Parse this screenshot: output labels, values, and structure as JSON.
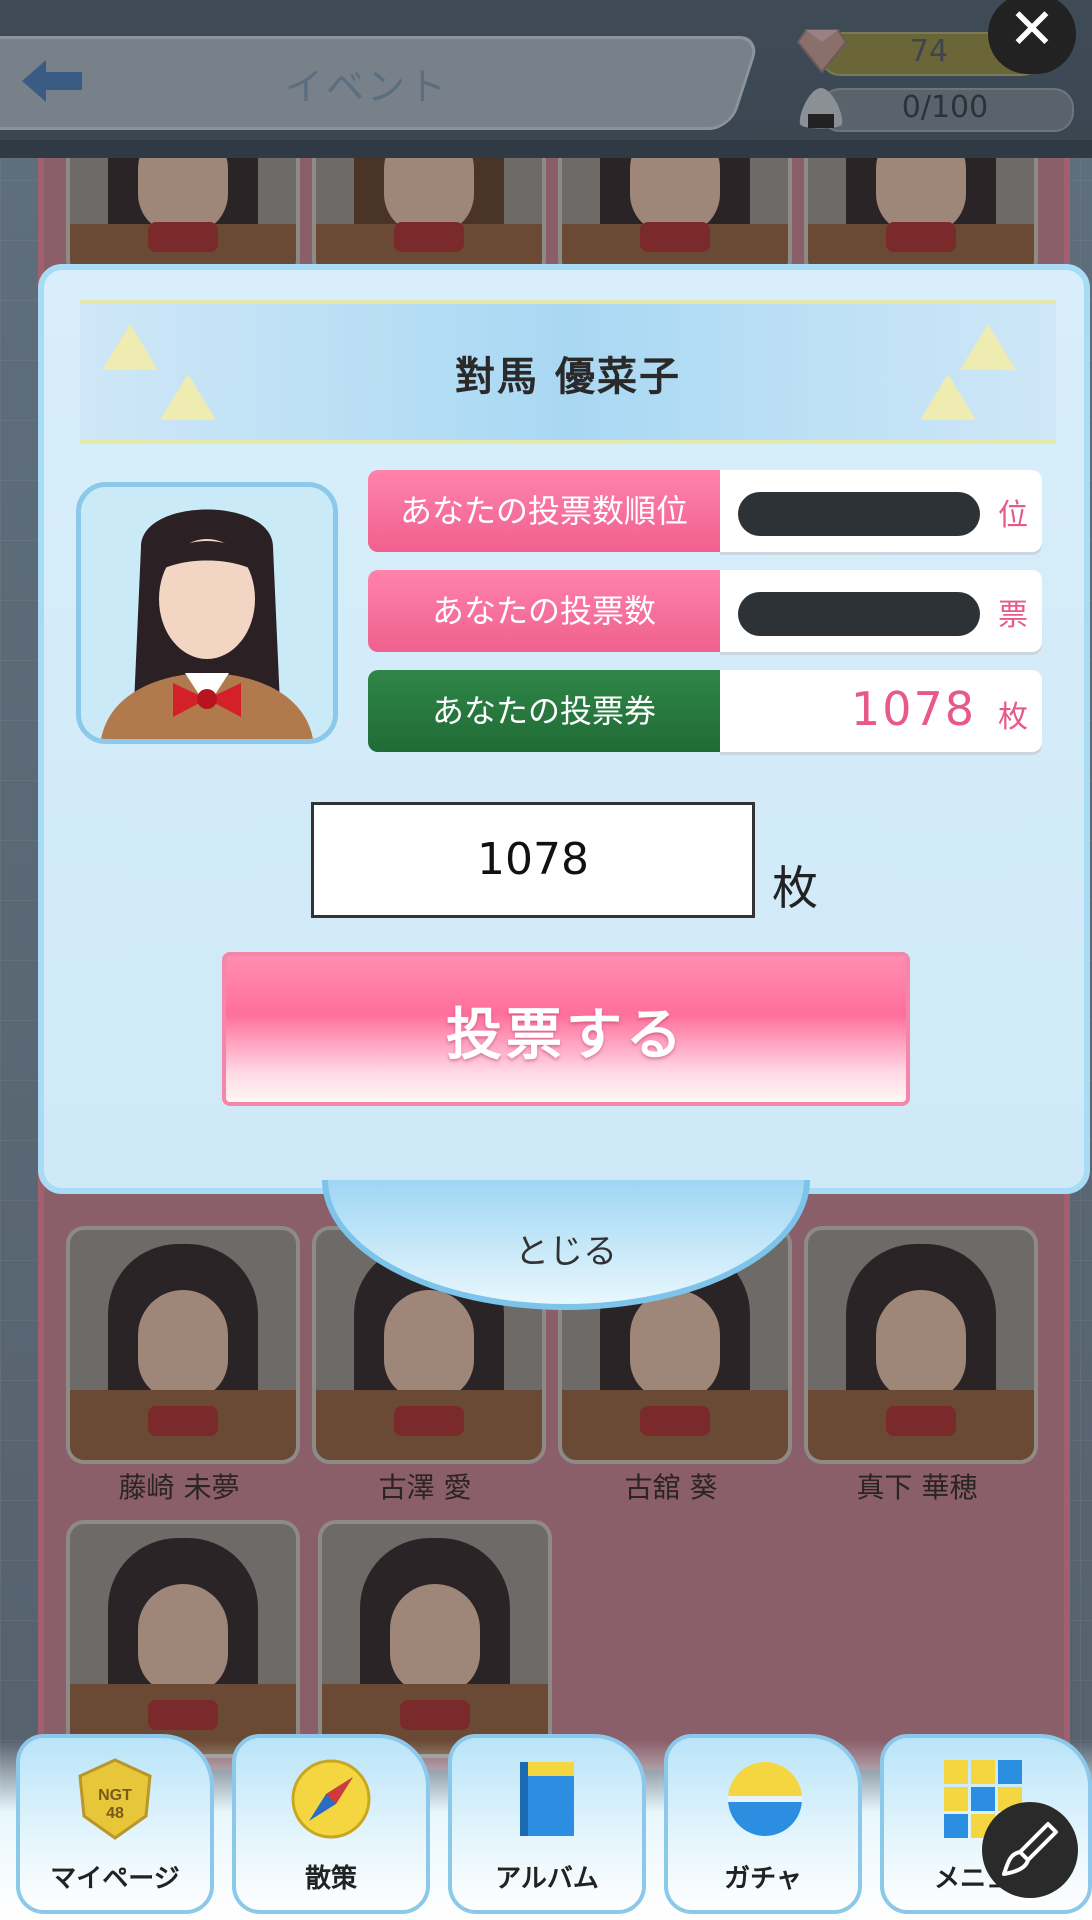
{
  "header": {
    "title": "イベント",
    "gem_count": "74",
    "stamina": "0/100",
    "close_glyph": "✕"
  },
  "modal": {
    "member_name": "對馬 優菜子",
    "stats": [
      {
        "label": "あなたの投票数順位",
        "unit": "位",
        "value_hidden": true
      },
      {
        "label": "あなたの投票数",
        "unit": "票",
        "value_hidden": true
      },
      {
        "label": "あなたの投票券",
        "value": "1078",
        "unit": "枚"
      }
    ],
    "quantity_input": "1078",
    "quantity_unit": "枚",
    "vote_button": "投票する",
    "close_button": "とじる"
  },
  "members": [
    {
      "name": "藤崎 未夢"
    },
    {
      "name": "古澤 愛"
    },
    {
      "name": "古舘 葵"
    },
    {
      "name": "真下 華穂"
    }
  ],
  "nav": {
    "items": [
      {
        "label": "マイページ",
        "icon": "ngt48-badge-icon"
      },
      {
        "label": "散策",
        "icon": "compass-icon"
      },
      {
        "label": "アルバム",
        "icon": "album-icon"
      },
      {
        "label": "ガチャ",
        "icon": "gacha-capsule-icon"
      },
      {
        "label": "メニュー",
        "icon": "menu-grid-icon"
      }
    ]
  },
  "colors": {
    "accent_pink": "#f0608f",
    "ticket_green": "#206b36",
    "modal_border": "#a8dbf5"
  }
}
